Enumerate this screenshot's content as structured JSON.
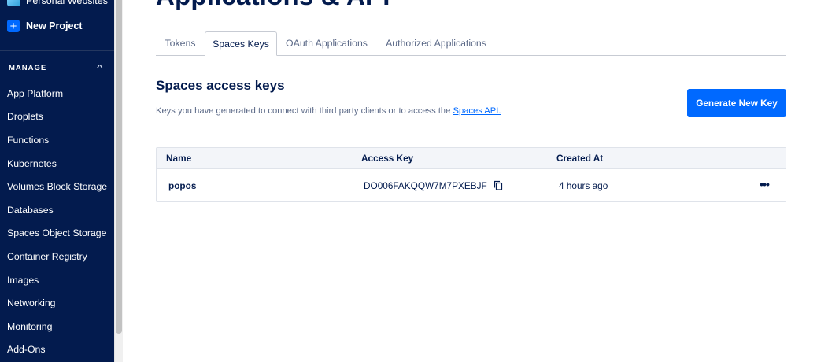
{
  "sidebar": {
    "project_partial": "Personal Websites",
    "new_project": "New Project",
    "new_project_icon": "plus-icon",
    "section_label": "MANAGE",
    "section_chevron": "chevron-up-icon",
    "items": [
      {
        "label": "App Platform"
      },
      {
        "label": "Droplets"
      },
      {
        "label": "Functions"
      },
      {
        "label": "Kubernetes"
      },
      {
        "label": "Volumes Block Storage"
      },
      {
        "label": "Databases"
      },
      {
        "label": "Spaces Object Storage"
      },
      {
        "label": "Container Registry"
      },
      {
        "label": "Images"
      },
      {
        "label": "Networking"
      },
      {
        "label": "Monitoring"
      },
      {
        "label": "Add-Ons"
      }
    ]
  },
  "page": {
    "title": "Applications & API"
  },
  "tabs": [
    {
      "label": "Tokens",
      "active": false
    },
    {
      "label": "Spaces Keys",
      "active": true
    },
    {
      "label": "OAuth Applications",
      "active": false
    },
    {
      "label": "Authorized Applications",
      "active": false
    }
  ],
  "section": {
    "title": "Spaces access keys",
    "description": "Keys you have generated to connect with third party clients or to access the ",
    "link_text": "Spaces API.",
    "button_label": "Generate New Key"
  },
  "table": {
    "headers": [
      "Name",
      "Access Key",
      "Created At"
    ],
    "rows": [
      {
        "name": "popos",
        "access_key": "DO006FAKQQW7M7PXEBJF",
        "created_at": "4 hours ago"
      }
    ],
    "copy_icon": "copy-icon",
    "more_icon": "more-horizontal-icon",
    "more_glyph": "•••"
  },
  "colors": {
    "sidebar_bg": "#031b4e",
    "accent": "#0069ff",
    "text_primary": "#031b4e",
    "text_muted": "#5b6987"
  }
}
